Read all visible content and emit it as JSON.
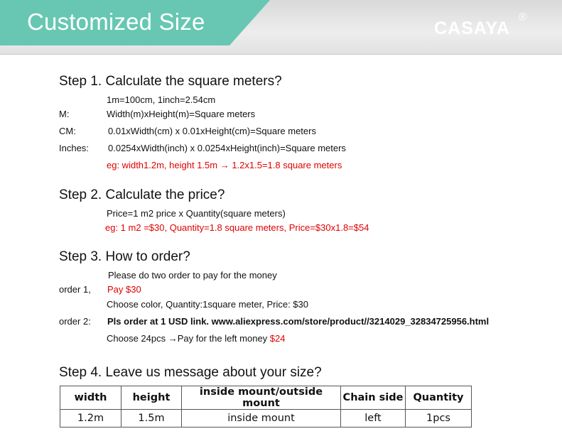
{
  "header": {
    "title": "Customized Size",
    "brand": "CASAYA",
    "brand_mark": "®"
  },
  "step1": {
    "title": "Step 1. Calculate the square meters?",
    "conversion": "1m=100cm, 1inch=2.54cm",
    "rows": [
      {
        "label": "M:",
        "formula": "Width(m)xHeight(m)=Square meters"
      },
      {
        "label": "CM:",
        "formula": "0.01xWidth(cm) x 0.01xHeight(cm)=Square meters"
      },
      {
        "label": "Inches:",
        "formula": "0.0254xWidth(inch) x 0.0254xHeight(inch)=Square meters"
      }
    ],
    "example": "eg: width1.2m, height 1.5m → 1.2x1.5=1.8 square meters"
  },
  "step2": {
    "title": "Step 2. Calculate the price?",
    "formula": "Price=1 m2 price x Quantity(square meters)",
    "example": "eg: 1 m2 =$30, Quantity=1.8 square meters, Price=$30x1.8=$54"
  },
  "step3": {
    "title": "Step 3. How to order?",
    "intro": "Please do two order to pay for the money",
    "order1_label": "order 1,",
    "order1_pay": "Pay $30",
    "order1_choose": "Choose color,  Quantity:1square meter, Price: $30",
    "order2_label": "order 2:",
    "order2_text": "Pls order at 1 USD link. www.aliexpress.com/store/product//3214029_32834725956.html",
    "order2_choose": "Choose 24pcs  →Pay for the left money ",
    "order2_amount": "$24"
  },
  "step4": {
    "title": "Step 4. Leave us message about your size?",
    "table": {
      "headers": [
        "width",
        "height",
        "inside mount/outside mount",
        "Chain side",
        "Quantity"
      ],
      "row": [
        "1.2m",
        "1.5m",
        "inside mount",
        "left",
        "1pcs"
      ]
    }
  },
  "colors": {
    "teal": "#67c7b3",
    "red": "#e00000"
  }
}
